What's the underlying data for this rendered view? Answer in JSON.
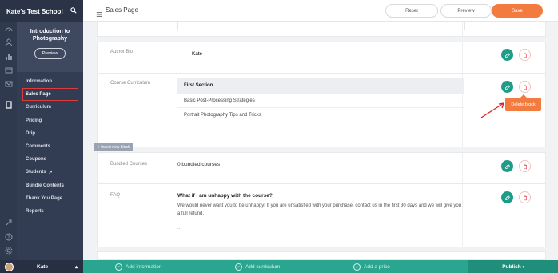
{
  "app": {
    "school_name": "Kate's Test School"
  },
  "course": {
    "title": "Introduction to Photography",
    "preview_label": "Preview"
  },
  "sidebar": {
    "items": [
      {
        "label": "Information"
      },
      {
        "label": "Sales Page"
      },
      {
        "label": "Curriculum"
      },
      {
        "label": "Pricing"
      },
      {
        "label": "Drip"
      },
      {
        "label": "Comments"
      },
      {
        "label": "Coupons"
      },
      {
        "label": "Students"
      },
      {
        "label": "Bundle Contents"
      },
      {
        "label": "Thank You Page"
      },
      {
        "label": "Reports"
      }
    ],
    "user_name": "Kate"
  },
  "header": {
    "title": "Sales Page",
    "reset_label": "Reset",
    "preview_label": "Preview",
    "save_label": "Save"
  },
  "blocks": {
    "author_bio": {
      "label": "Author Bio",
      "value": "Kate"
    },
    "course_curriculum": {
      "label": "Course Curriculum",
      "rows": [
        "First Section",
        "Basic Post-Processing Strategies",
        "Portrait Photography Tips and Tricks",
        "..."
      ]
    },
    "bundled_courses": {
      "label": "Bundled Courses",
      "value": "0 bundled courses"
    },
    "faq": {
      "label": "FAQ",
      "question": "What if I am unhappy with the course?",
      "answer": "We would never want you to be unhappy! If you are unsatisfied with your purchase, contact us in the first 30 days and we will give you a full refund.",
      "more": "..."
    }
  },
  "tooltip": {
    "label": "Delete block"
  },
  "insert_block_label": "+ Insert new block",
  "bottom_bar": {
    "steps": [
      "Add information",
      "Add curriculum",
      "Add a price"
    ],
    "publish_label": "Publish ›"
  },
  "colors": {
    "accent_orange": "#f47b3f",
    "teal": "#2aa590",
    "sidebar": "#323c52",
    "highlight_red": "#e03b3b"
  }
}
